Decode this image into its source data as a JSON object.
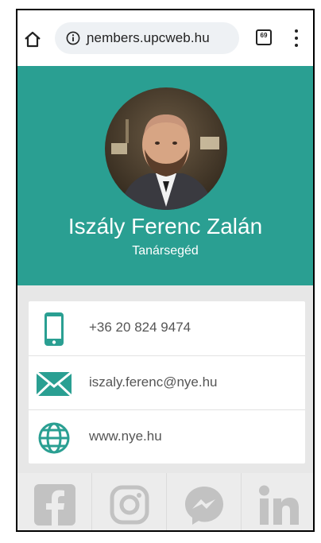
{
  "browser": {
    "url": "ɲembers.upcweb.hu",
    "tab_count": "69",
    "icons": [
      "home-icon",
      "info-icon",
      "tabs-icon",
      "menu-icon"
    ]
  },
  "profile": {
    "name": "Iszály Ferenc Zalán",
    "title": "Tanársegéd"
  },
  "contacts": {
    "phone": "+36 20 824 9474",
    "email": "iszaly.ferenc@nye.hu",
    "website": "www.nye.hu"
  },
  "social": [
    "facebook-icon",
    "instagram-icon",
    "messenger-icon",
    "linkedin-icon"
  ],
  "colors": {
    "accent": "#2a9f92",
    "social_gray": "#c2c2c2"
  }
}
